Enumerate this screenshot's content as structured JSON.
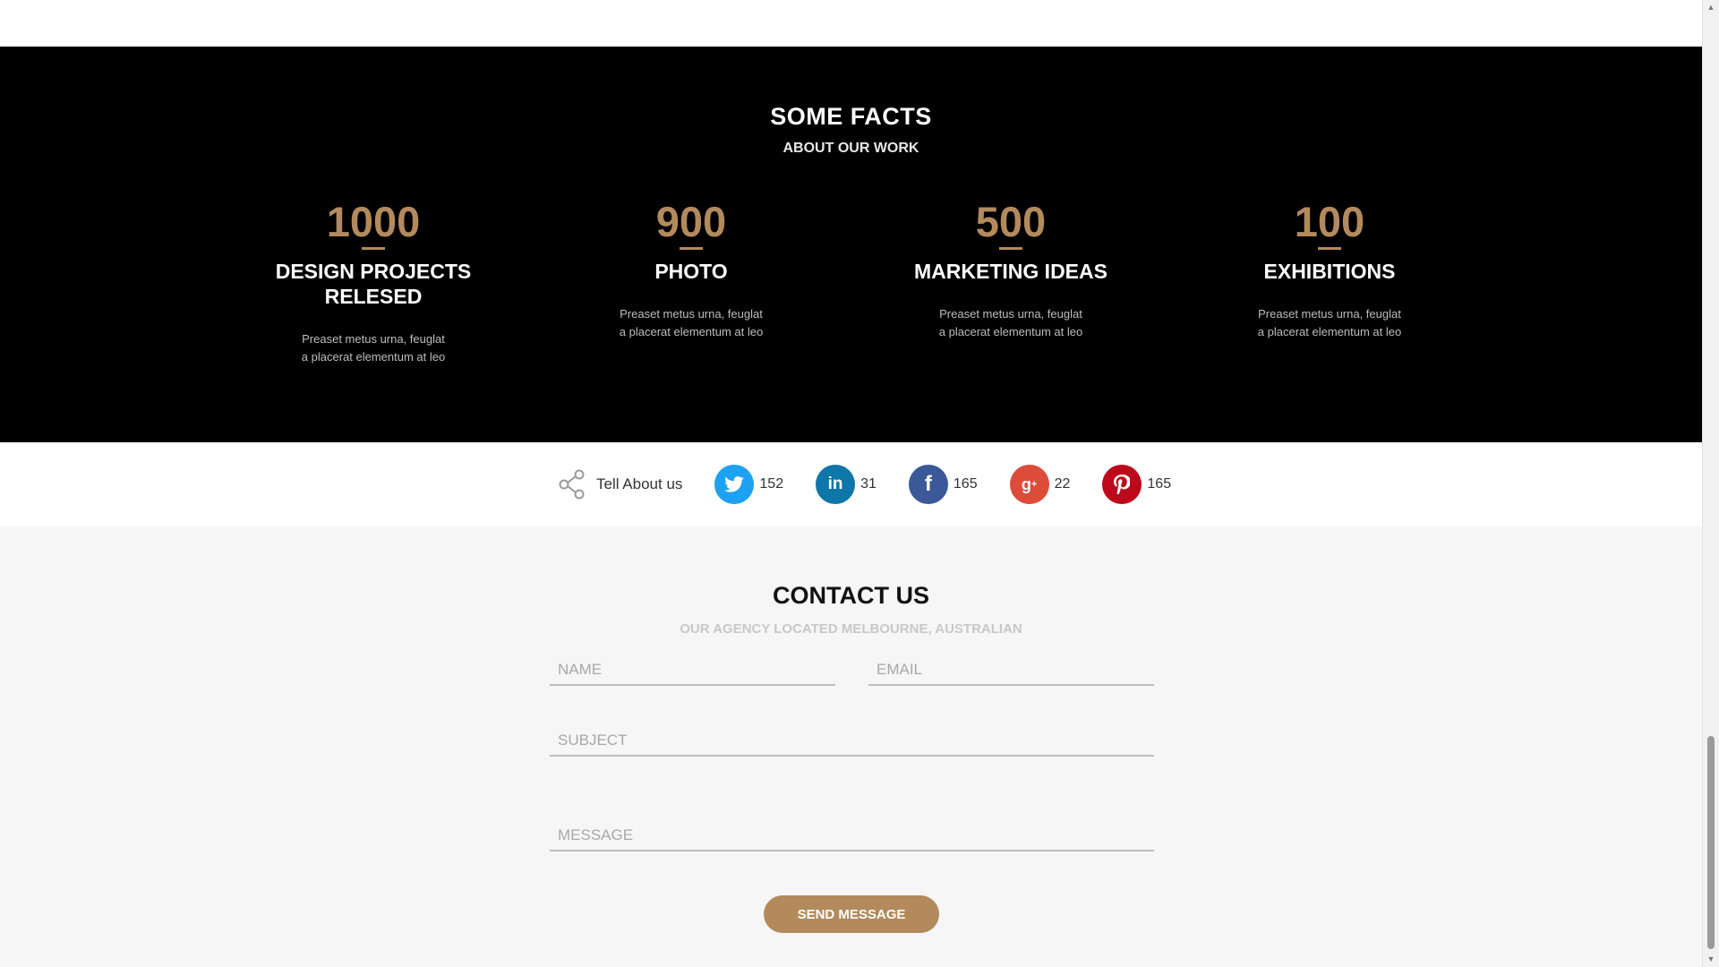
{
  "facts": {
    "title": "SOME FACTS",
    "subtitle": "ABOUT OUR WORK",
    "items": [
      {
        "number": "1000",
        "label_line1": "DESIGN PROJECTS",
        "label_line2": "RELESED",
        "desc_line1": "Preaset metus urna, feuglat",
        "desc_line2": "a placerat elementum at leo"
      },
      {
        "number": "900",
        "label_line1": "PHOTO",
        "label_line2": "",
        "desc_line1": "Preaset metus urna, feuglat",
        "desc_line2": "a placerat elementum at leo"
      },
      {
        "number": "500",
        "label_line1": "MARKETING IDEAS",
        "label_line2": "",
        "desc_line1": "Preaset metus urna, feuglat",
        "desc_line2": "a placerat elementum at leo"
      },
      {
        "number": "100",
        "label_line1": "EXHIBITIONS",
        "label_line2": "",
        "desc_line1": "Preaset metus urna, feuglat",
        "desc_line2": "a placerat elementum at leo"
      }
    ]
  },
  "social": {
    "share_label": "Tell About us",
    "networks": [
      {
        "name": "twitter",
        "glyph": "t",
        "color": "#1da1f2",
        "count": "152"
      },
      {
        "name": "linkedin",
        "glyph": "in",
        "color": "#0e76a8",
        "count": "31"
      },
      {
        "name": "facebook",
        "glyph": "f",
        "color": "#3b5998",
        "count": "165"
      },
      {
        "name": "google-plus",
        "glyph": "g+",
        "color": "#dd4b39",
        "count": "22"
      },
      {
        "name": "pinterest",
        "glyph": "p",
        "color": "#bd081c",
        "count": "165"
      }
    ]
  },
  "contact": {
    "title": "CONTACT US",
    "subtitle": "OUR AGENCY LOCATED MELBOURNE, AUSTRALIAN",
    "name_placeholder": "NAME",
    "email_placeholder": "EMAIL",
    "subject_placeholder": "SUBJECT",
    "message_placeholder": "MESSAGE",
    "send_label": "SEND MESSAGE"
  },
  "colors": {
    "accent": "#b38a5c",
    "facts_bg": "#000000",
    "contact_bg": "#f6f6f6"
  }
}
